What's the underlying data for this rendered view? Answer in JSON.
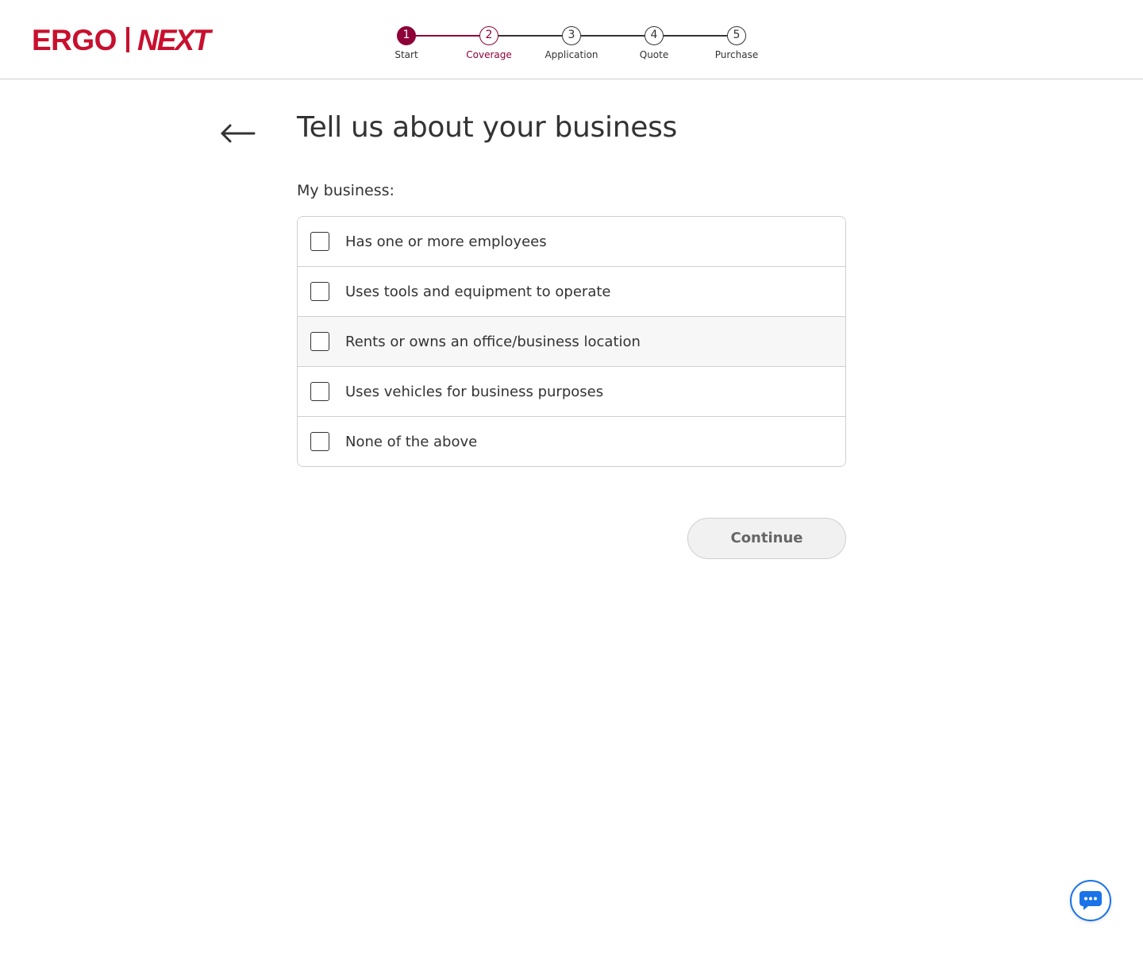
{
  "brand": {
    "left": "ERGO",
    "right": "NEXT",
    "color": "#c8102e"
  },
  "stepper": {
    "steps": [
      {
        "number": "1",
        "label": "Start",
        "state": "done"
      },
      {
        "number": "2",
        "label": "Coverage",
        "state": "current"
      },
      {
        "number": "3",
        "label": "Application",
        "state": "upcoming"
      },
      {
        "number": "4",
        "label": "Quote",
        "state": "upcoming"
      },
      {
        "number": "5",
        "label": "Purchase",
        "state": "upcoming"
      }
    ],
    "accent": "#8e0038"
  },
  "page": {
    "title": "Tell us about your business",
    "subtitle": "My business:",
    "options": [
      {
        "label": "Has one or more employees",
        "checked": false
      },
      {
        "label": "Uses tools and equipment to operate",
        "checked": false
      },
      {
        "label": "Rents or owns an office/business location",
        "checked": false
      },
      {
        "label": "Uses vehicles for business purposes",
        "checked": false
      },
      {
        "label": "None of the above",
        "checked": false
      }
    ],
    "continue_label": "Continue"
  },
  "icons": {
    "back": "arrow-left-icon",
    "chat": "chat-bubble-icon"
  },
  "chat": {
    "color": "#1a73e8"
  }
}
